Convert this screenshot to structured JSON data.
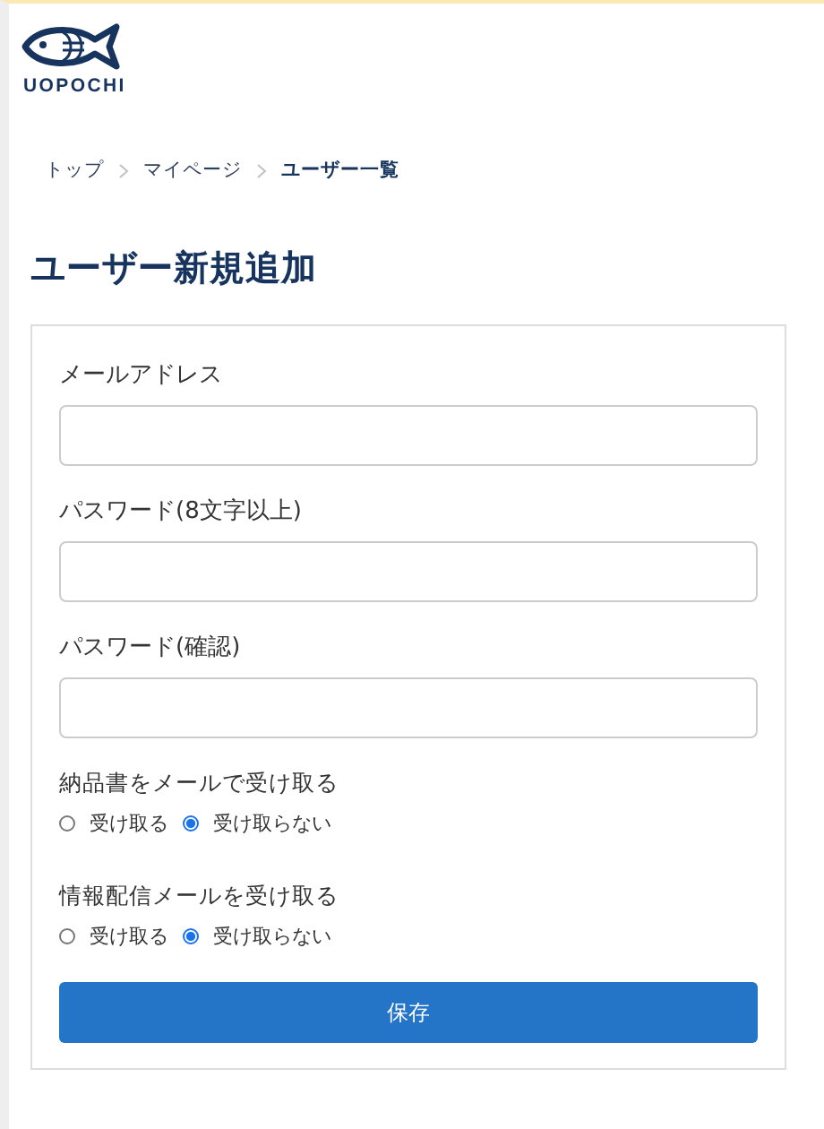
{
  "logo": {
    "text": "UOPOCHI"
  },
  "breadcrumb": [
    {
      "label": "トップ",
      "current": false
    },
    {
      "label": "マイページ",
      "current": false
    },
    {
      "label": "ユーザー一覧",
      "current": true
    }
  ],
  "page_title": "ユーザー新規追加",
  "fields": [
    {
      "label": "メールアドレス"
    },
    {
      "label": "パスワード(8文字以上)"
    },
    {
      "label": "パスワード(確認)"
    }
  ],
  "radio_groups": [
    {
      "label": "納品書をメールで受け取る",
      "options": [
        {
          "label": "受け取る",
          "selected": false
        },
        {
          "label": "受け取らない",
          "selected": true
        }
      ]
    },
    {
      "label": "情報配信メールを受け取る",
      "options": [
        {
          "label": "受け取る",
          "selected": false
        },
        {
          "label": "受け取らない",
          "selected": true
        }
      ]
    }
  ],
  "save_button": "保存"
}
